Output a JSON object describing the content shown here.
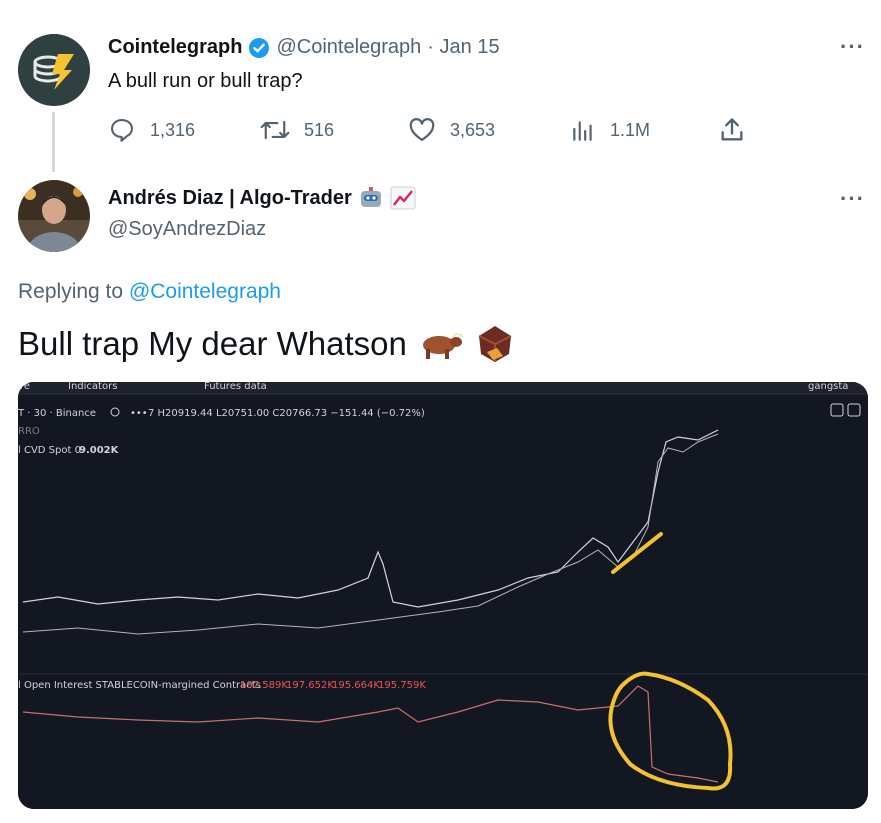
{
  "original_tweet": {
    "author_name": "Cointelegraph",
    "handle": "@Cointelegraph",
    "date": "· Jan 15",
    "text": "A bull run or bull trap?",
    "stats": {
      "replies": "1,316",
      "retweets": "516",
      "likes": "3,653",
      "views": "1.1M"
    }
  },
  "reply_tweet": {
    "author_name": "Andrés Diaz | Algo-Trader",
    "handle": "@SoyAndrezDiaz",
    "replying_label": "Replying to",
    "replying_handle": "@Cointelegraph",
    "text": "Bull trap My dear Whatson"
  },
  "chart_image": {
    "menu_items": [
      "re",
      "Indicators",
      "Futures data",
      "gangsta"
    ],
    "symbol_line": "T · 30 · Binance",
    "ohlc": "7 H20919.44 L20751.00 C20766.73 −151.44 (−0.72%)",
    "error_label": "RRO",
    "cvd_label": "l CVD Spot 0",
    "cvd_value": "9.002K",
    "oi_label": "l Open Interest STABLECOIN-margined Contracts",
    "oi_values": [
      "197.589K",
      "197.652K",
      "195.664K",
      "195.759K"
    ],
    "colors": {
      "background": "#131722",
      "price_line": "#d1d4dc",
      "oi_line": "#c9706f",
      "annotation": "#f2c230"
    }
  },
  "colors": {
    "link": "#1d9bf0",
    "muted": "#536471",
    "verified": "#1d9bf0"
  }
}
